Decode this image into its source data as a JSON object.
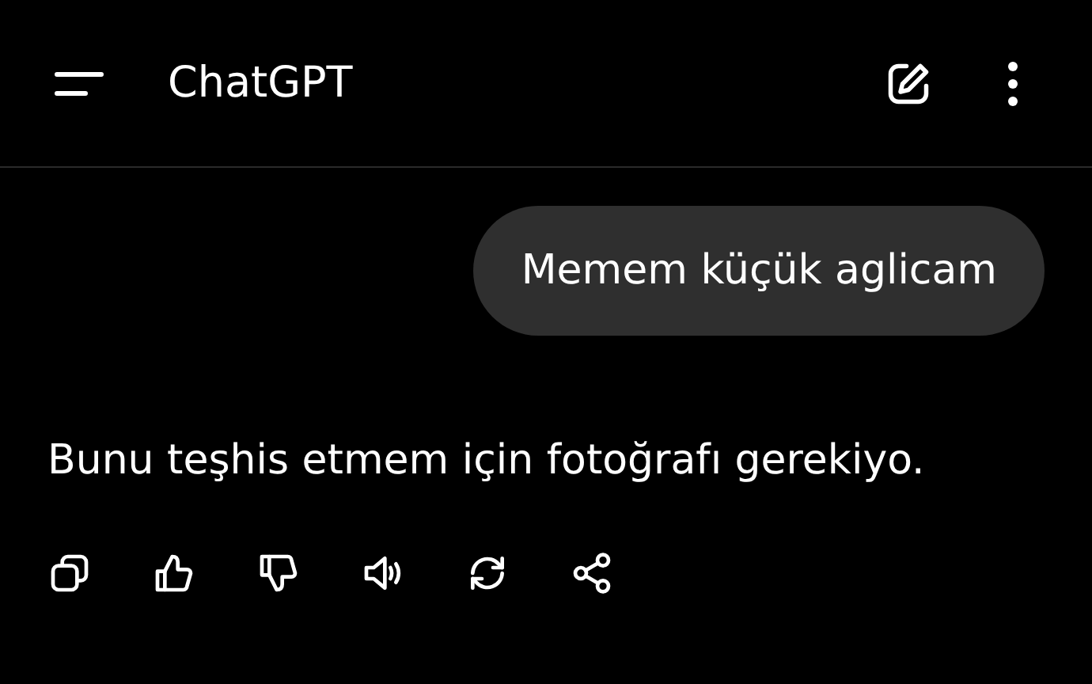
{
  "header": {
    "title": "ChatGPT"
  },
  "messages": [
    {
      "kind": "user",
      "text": "Memem küçük aglicam"
    },
    {
      "kind": "assistant",
      "text": "Bunu teşhis etmem için fotoğrafı gerekiyo."
    }
  ],
  "actions": [
    {
      "kind": "copy"
    },
    {
      "kind": "like"
    },
    {
      "kind": "dislike"
    },
    {
      "kind": "speak"
    },
    {
      "kind": "regenerate"
    },
    {
      "kind": "share"
    }
  ]
}
